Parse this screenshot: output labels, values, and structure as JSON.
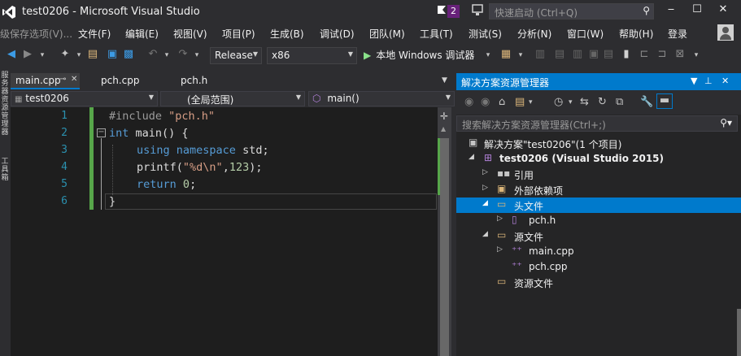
{
  "window": {
    "title": "test0206 - Microsoft Visual Studio",
    "notification_count": "2",
    "quick_launch_placeholder": "快速启动 (Ctrl+Q)",
    "minimize": "‒",
    "maximize": "☐",
    "close": "✕"
  },
  "menu": {
    "truncated_left": "级保存选项(V)...",
    "items": [
      "文件(F)",
      "编辑(E)",
      "视图(V)",
      "项目(P)",
      "生成(B)",
      "调试(D)",
      "团队(M)",
      "工具(T)",
      "测试(S)",
      "分析(N)",
      "窗口(W)",
      "帮助(H)",
      "登录"
    ]
  },
  "toolbar": {
    "configuration": "Release",
    "platform": "x86",
    "run_label": "本地 Windows 调试器"
  },
  "left_strip": {
    "tab1": "服务器资源管理器",
    "tab2": "工具箱"
  },
  "editor": {
    "tabs": [
      {
        "label": "main.cpp",
        "active": true
      },
      {
        "label": "pch.cpp",
        "active": false
      },
      {
        "label": "pch.h",
        "active": false
      }
    ],
    "nav": {
      "project": "test0206",
      "scope": "(全局范围)",
      "member": "main()"
    },
    "line_numbers": [
      "1",
      "2",
      "3",
      "4",
      "5",
      "6"
    ],
    "code": {
      "l1_pp": "#include ",
      "l1_str": "\"pch.h\"",
      "l2_kw": "int",
      "l2_rest": " main() {",
      "l3_kw1": "using",
      "l3_kw2": "namespace",
      "l3_rest": " std;",
      "l4_fn": "printf(",
      "l4_str": "\"%d\\n\"",
      "l4_sep": ",",
      "l4_num": "123",
      "l4_end": ");",
      "l5_kw": "return",
      "l5_num": "0",
      "l5_end": ";",
      "l6": "}"
    }
  },
  "solution_explorer": {
    "title": "解决方案资源管理器",
    "search_placeholder": "搜索解决方案资源管理器(Ctrl+;)",
    "tree": {
      "solution": "解决方案\"test0206\"(1 个项目)",
      "project": "test0206 (Visual Studio 2015)",
      "references": "引用",
      "external_deps": "外部依赖项",
      "header_files": "头文件",
      "pch_h": "pch.h",
      "source_files": "源文件",
      "main_cpp": "main.cpp",
      "pch_cpp": "pch.cpp",
      "resource_files": "资源文件"
    }
  },
  "colors": {
    "accent": "#007acc",
    "background": "#2d2d30",
    "editor_bg": "#1e1e1e",
    "keyword": "#569cd6",
    "string": "#d69d85",
    "line_number": "#2b91af"
  }
}
